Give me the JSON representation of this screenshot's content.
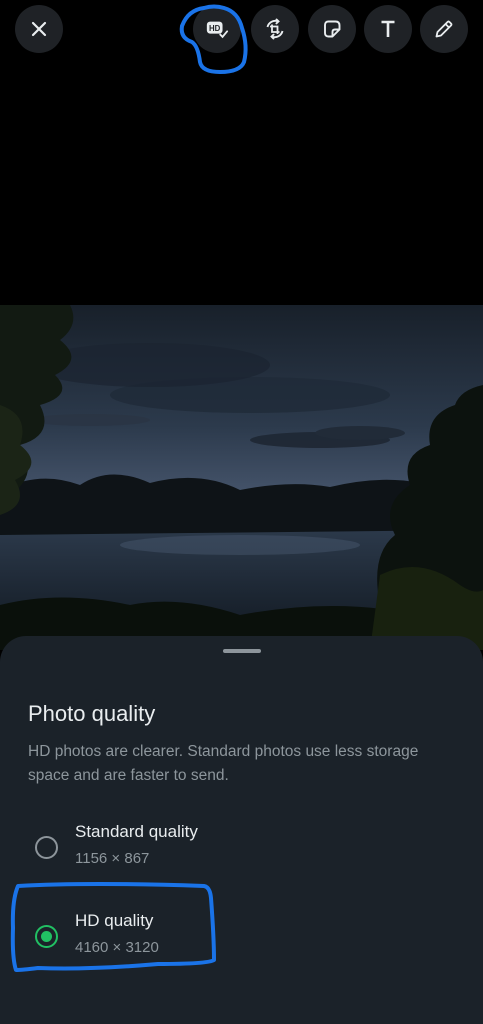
{
  "toolbar": {
    "items": [
      {
        "name": "close",
        "icon": "close-icon"
      },
      {
        "name": "hd",
        "icon": "hd-check-icon",
        "label": "HD"
      },
      {
        "name": "crop-rotate",
        "icon": "crop-rotate-icon"
      },
      {
        "name": "sticker",
        "icon": "sticker-icon"
      },
      {
        "name": "text",
        "icon": "text-icon",
        "label": "T"
      },
      {
        "name": "draw",
        "icon": "pencil-icon"
      }
    ]
  },
  "sheet": {
    "title": "Photo quality",
    "description": "HD photos are clearer. Standard photos use less storage space and are faster to send.",
    "options": [
      {
        "label": "Standard quality",
        "size": "1156 × 867",
        "selected": false
      },
      {
        "label": "HD quality",
        "size": "4160 × 3120",
        "selected": true
      }
    ]
  },
  "colors": {
    "background": "#000000",
    "sheet": "#1b2229",
    "accent": "#21c063",
    "annotation": "#1a73e8"
  }
}
